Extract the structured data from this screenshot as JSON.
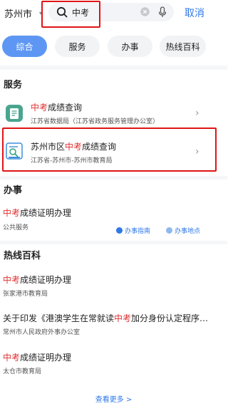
{
  "header": {
    "city": "苏州市",
    "search_query": "中考",
    "cancel_label": "取消"
  },
  "tabs": [
    {
      "label": "综合",
      "active": true
    },
    {
      "label": "服务",
      "active": false
    },
    {
      "label": "办事",
      "active": false
    },
    {
      "label": "热线百科",
      "active": false
    }
  ],
  "services": {
    "title": "服务",
    "items": [
      {
        "title_hl": "中考",
        "title_rest": "成绩查询",
        "subtitle": "江苏省数据局（江苏省政务服务管理办公室）"
      },
      {
        "title_pre": "苏州市区",
        "title_hl": "中考",
        "title_rest": "成绩查询",
        "subtitle": "江苏省-苏州市-苏州市教育局"
      }
    ]
  },
  "affairs": {
    "title": "办事",
    "item": {
      "title_hl": "中考",
      "title_rest": "成绩证明办理",
      "subtitle": "公共服务",
      "guide_label": "办事指南",
      "location_label": "办事地点"
    }
  },
  "hotline": {
    "title": "热线百科",
    "items": [
      {
        "title_hl": "中考",
        "title_rest": "成绩证明办理",
        "subtitle": "张家港市教育局"
      },
      {
        "title_pre": "关于印发《港澳学生在常就读",
        "title_hl": "中考",
        "title_rest": "加分身份认定程序…",
        "subtitle": "常州市人民政府外事办公室"
      },
      {
        "title_hl": "中考",
        "title_rest": "成绩证明办理",
        "subtitle": "太仓市教育局"
      }
    ],
    "more_label": "查看更多 >"
  },
  "colors": {
    "accent": "#2f78e8",
    "highlight": "#e03030",
    "tab_active": "#5d97f3",
    "annotation": "#e01414"
  }
}
